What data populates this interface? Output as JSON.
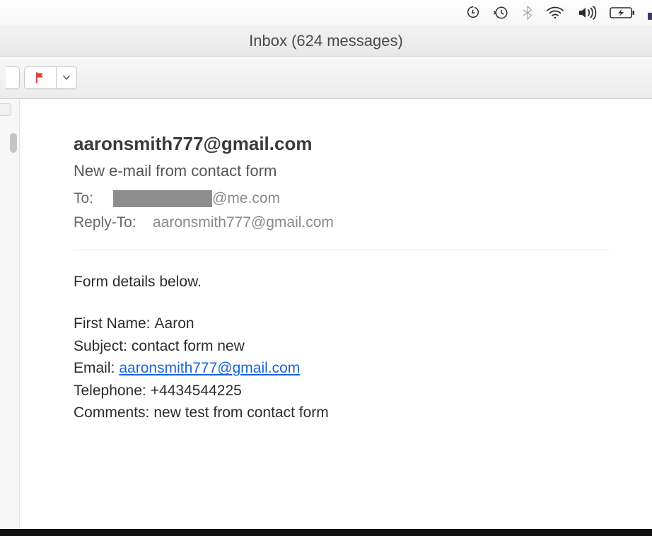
{
  "titlebar": "Inbox (624 messages)",
  "message": {
    "from": "aaronsmith777@gmail.com",
    "subject": "New e-mail from contact form",
    "to_label": "To:",
    "to_domain": "@me.com",
    "reply_to_label": "Reply-To:",
    "reply_to": "aaronsmith777@gmail.com",
    "body_intro": "Form details below.",
    "fields": {
      "first_name_label": "First Name:",
      "first_name": "Aaron",
      "subject_label": "Subject:",
      "subject": "contact form new",
      "email_label": "Email:",
      "email": "aaronsmith777@gmail.com",
      "telephone_label": "Telephone:",
      "telephone": "+4434544225",
      "comments_label": "Comments:",
      "comments": "new test from contact form"
    }
  }
}
